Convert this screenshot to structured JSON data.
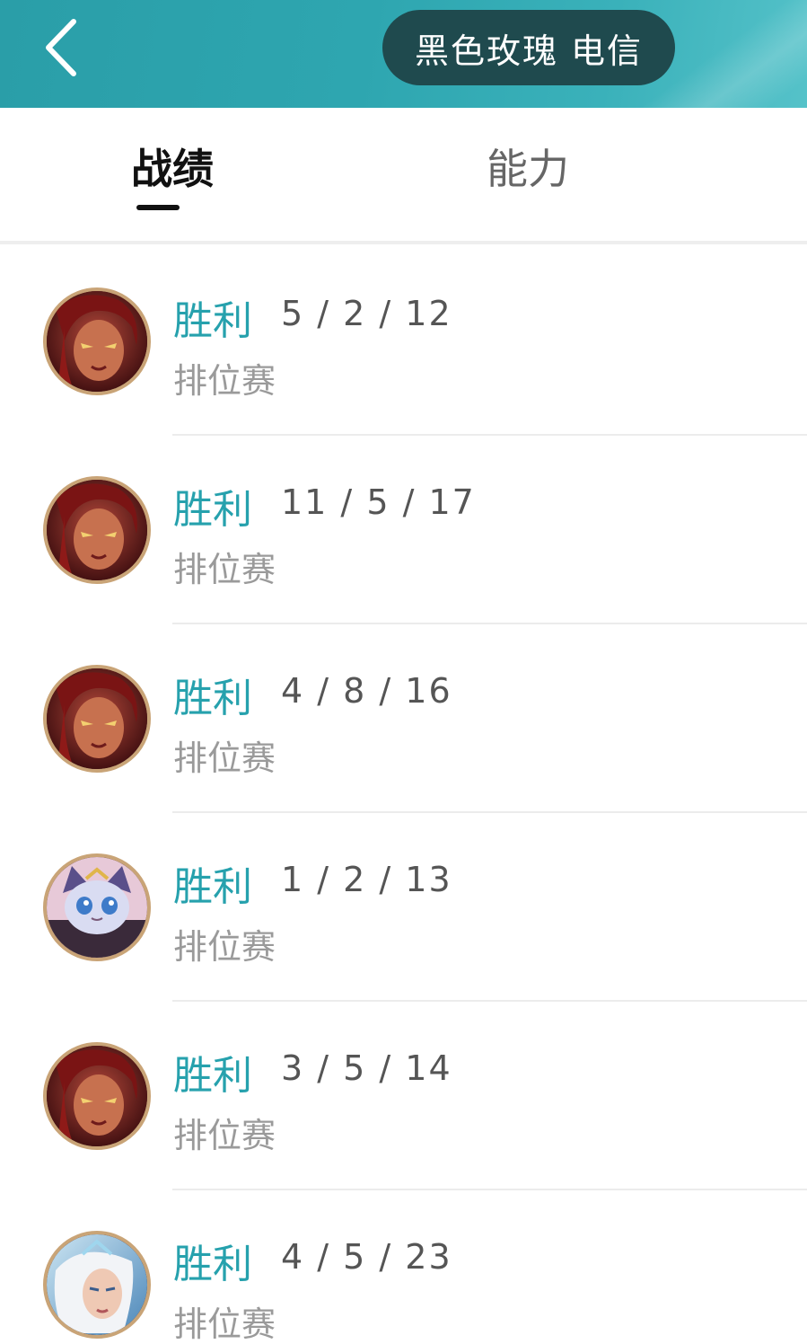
{
  "header": {
    "title": "黑色玫瑰 电信",
    "back_icon": "chevron-left-icon"
  },
  "tabs": [
    {
      "label": "战绩",
      "active": true
    },
    {
      "label": "能力",
      "active": false
    }
  ],
  "matches": [
    {
      "result": "胜利",
      "kda": "5 / 2 / 12",
      "mode": "排位赛",
      "champion_icon": "zyra"
    },
    {
      "result": "胜利",
      "kda": "11 / 5 / 17",
      "mode": "排位赛",
      "champion_icon": "zyra"
    },
    {
      "result": "胜利",
      "kda": "4 / 8 / 16",
      "mode": "排位赛",
      "champion_icon": "zyra"
    },
    {
      "result": "胜利",
      "kda": "1 / 2 / 13",
      "mode": "排位赛",
      "champion_icon": "yuumi"
    },
    {
      "result": "胜利",
      "kda": "3 / 5 / 14",
      "mode": "排位赛",
      "champion_icon": "zyra"
    },
    {
      "result": "胜利",
      "kda": "4 / 5 / 23",
      "mode": "排位赛",
      "champion_icon": "janna"
    }
  ],
  "colors": {
    "header_bg": "#2ea6b0",
    "win_text": "#26a1ad",
    "pill_bg": "#1f4a4e",
    "avatar_ring": "#c9a477"
  }
}
